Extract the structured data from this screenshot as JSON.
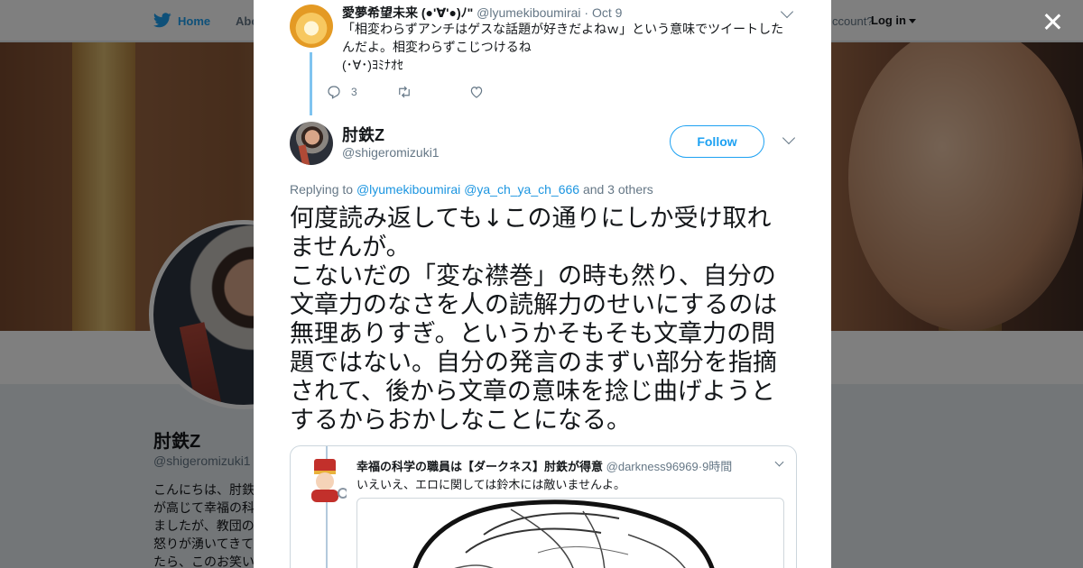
{
  "background": {
    "nav": {
      "home_label": "Home",
      "about_label": "Abo",
      "have_account": "ccount?",
      "login_label": "Log in"
    },
    "profile": {
      "name": "肘鉄Z",
      "handle": "@shigeromizuki1",
      "bio_lines": [
        "こんにちは、肘鉄",
        "が高じて幸福の科",
        "ましたが、教団の",
        "怒りが湧いてきて",
        "たら、このお笑い"
      ]
    }
  },
  "modal": {
    "parent_tweet": {
      "name": "愛夢希望未来 (●'∀'●)ﾉ\"",
      "handle": "@lyumekiboumirai",
      "dot": "·",
      "time": "Oct 9",
      "text_lines": [
        "「相変わらずアンチはゲスな話題が好きだよねｗ」という意味でツイートした",
        "んだよ。相変わらずこじつけるね",
        "(･∀･)ﾖﾐﾅｵｾ"
      ],
      "reply_count": "3",
      "retweet_count": "",
      "like_count": ""
    },
    "main_tweet": {
      "name": "肘鉄Z",
      "handle": "@shigeromizuki1",
      "follow_label": "Follow",
      "replying_prefix": "Replying to",
      "replying_user1": "@lyumekiboumirai",
      "replying_user2": "@ya_ch_ya_ch_666",
      "replying_suffix": "and 3 others",
      "text_lines": [
        "何度読み返しても↓この通りにしか受け取れ",
        "ませんが。",
        "こないだの「変な襟巻」の時も然り、自分の",
        "文章力のなさを人の読解力のせいにするのは",
        "無理ありすぎ。というかそもそも文章力の問",
        "題ではない。自分の発言のまずい部分を指摘",
        "されて、後から文章の意味を捻じ曲げようと",
        "するからおかしなことになる。"
      ],
      "media": {
        "quoted_name": "幸福の科学の職員は【ダークネス】肘鉄が得意",
        "quoted_handle": "@darkness96969",
        "quoted_time": "·9時間",
        "quoted_text": "いえいえ、エロに関しては鈴木には敵いませんよ。"
      }
    }
  },
  "colors": {
    "link": "#1b95e0",
    "accent": "#1da1f2",
    "muted": "#657786"
  }
}
